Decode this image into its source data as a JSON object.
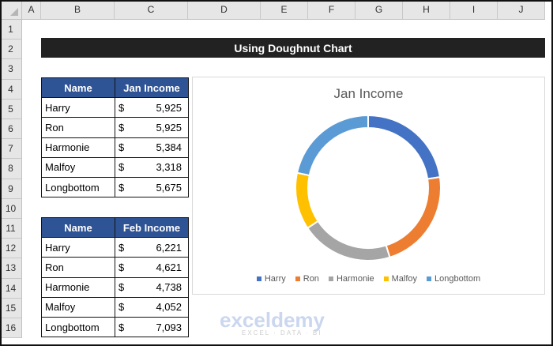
{
  "columns": [
    "A",
    "B",
    "C",
    "D",
    "E",
    "F",
    "G",
    "H",
    "I",
    "J"
  ],
  "rows": [
    "1",
    "2",
    "3",
    "4",
    "5",
    "6",
    "7",
    "8",
    "9",
    "10",
    "11",
    "12",
    "13",
    "14",
    "15",
    "16"
  ],
  "title": "Using Doughnut Chart",
  "jan_table": {
    "headers": [
      "Name",
      "Jan Income"
    ],
    "rows": [
      {
        "name": "Harry",
        "cur": "$",
        "value": "5,925"
      },
      {
        "name": "Ron",
        "cur": "$",
        "value": "5,925"
      },
      {
        "name": "Harmonie",
        "cur": "$",
        "value": "5,384"
      },
      {
        "name": "Malfoy",
        "cur": "$",
        "value": "3,318"
      },
      {
        "name": "Longbottom",
        "cur": "$",
        "value": "5,675"
      }
    ]
  },
  "feb_table": {
    "headers": [
      "Name",
      "Feb Income"
    ],
    "rows": [
      {
        "name": "Harry",
        "cur": "$",
        "value": "6,221"
      },
      {
        "name": "Ron",
        "cur": "$",
        "value": "4,621"
      },
      {
        "name": "Harmonie",
        "cur": "$",
        "value": "4,738"
      },
      {
        "name": "Malfoy",
        "cur": "$",
        "value": "4,052"
      },
      {
        "name": "Longbottom",
        "cur": "$",
        "value": "7,093"
      }
    ]
  },
  "chart_data": {
    "type": "pie",
    "variant": "doughnut",
    "title": "Jan Income",
    "categories": [
      "Harry",
      "Ron",
      "Harmonie",
      "Malfoy",
      "Longbottom"
    ],
    "values": [
      5925,
      5925,
      5384,
      3318,
      5675
    ],
    "colors": [
      "#4472c4",
      "#ed7d31",
      "#a5a5a5",
      "#ffc000",
      "#5b9bd5"
    ],
    "legend": "bottom"
  },
  "watermark": {
    "name": "exceldemy",
    "tagline": "EXCEL · DATA · BI"
  }
}
